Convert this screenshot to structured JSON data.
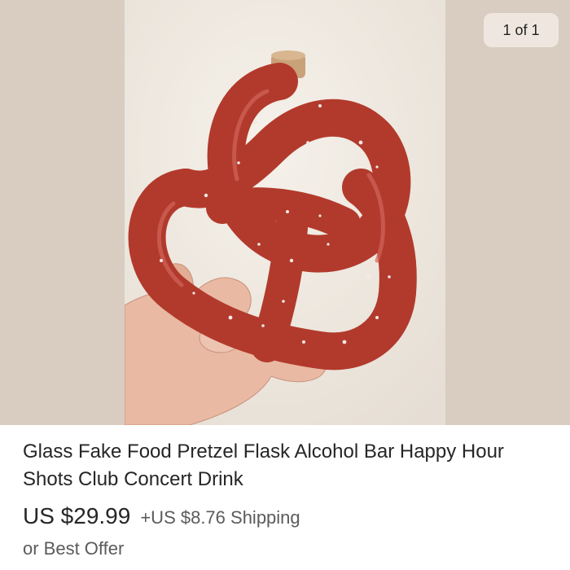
{
  "gallery": {
    "counter": "1 of 1",
    "image_subject": "red speckled ceramic pretzel-shaped flask with cork held in a hand"
  },
  "listing": {
    "title": "Glass Fake Food Pretzel Flask Alcohol Bar Happy Hour Shots Club Concert Drink",
    "price": "US $29.99",
    "shipping": "+US $8.76 Shipping",
    "offer": "or Best Offer"
  },
  "colors": {
    "gallery_bg": "#d9ccc1",
    "wall": "#efe9e1",
    "pretzel": "#b23a2c",
    "counter_bg": "#efe7df"
  }
}
